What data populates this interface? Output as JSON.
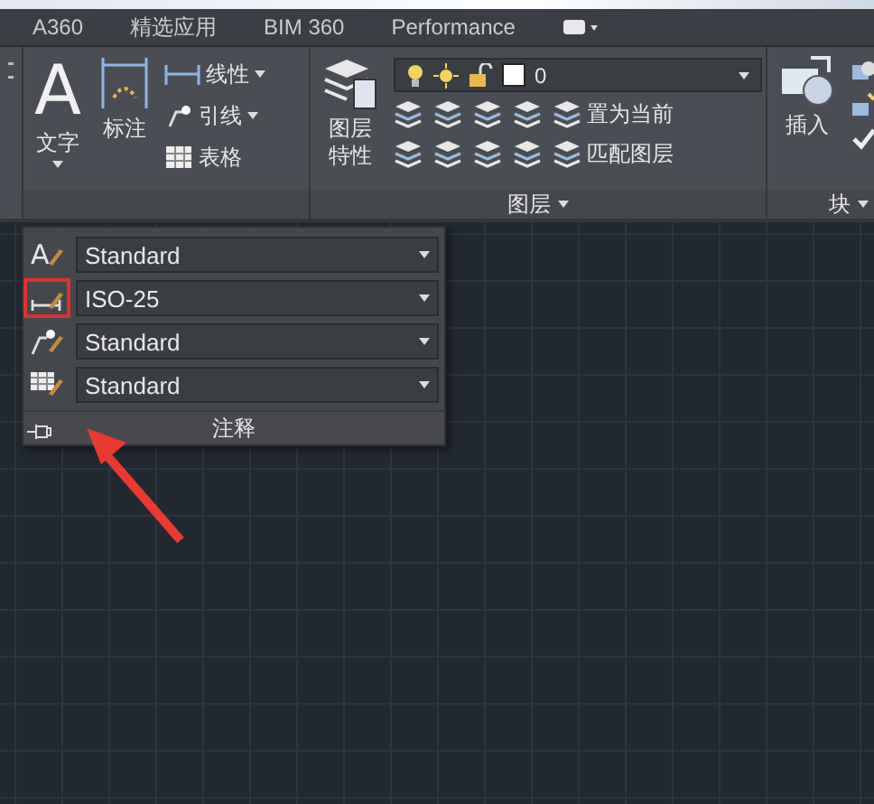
{
  "tabs": [
    {
      "label": "A360",
      "selected": false
    },
    {
      "label": "精选应用",
      "selected": false
    },
    {
      "label": "BIM 360",
      "selected": false
    },
    {
      "label": "Performance",
      "selected": false
    }
  ],
  "text_panel": {
    "text_glyph": "A",
    "text_tool": "文字",
    "dim_tool": "标注",
    "small_tools": [
      {
        "kind": "linear",
        "label": "线性",
        "dropdown": true
      },
      {
        "kind": "leader",
        "label": "引线",
        "dropdown": true
      },
      {
        "kind": "table",
        "label": "表格",
        "dropdown": false
      }
    ]
  },
  "layer_panel": {
    "properties_button": "图层特性",
    "current_layer": "0",
    "set_current": "置为当前",
    "match_layer": "匹配图层",
    "title": "图层"
  },
  "block_panel": {
    "insert_button": "插入",
    "title": "块"
  },
  "annotation_popup": {
    "title": "注释",
    "rows": [
      {
        "kind": "text",
        "glyph": "A",
        "value": "Standard",
        "highlighted": false
      },
      {
        "kind": "dimension",
        "value": "ISO-25",
        "highlighted": true
      },
      {
        "kind": "leader",
        "value": "Standard",
        "highlighted": false
      },
      {
        "kind": "table",
        "value": "Standard",
        "highlighted": false
      }
    ]
  }
}
